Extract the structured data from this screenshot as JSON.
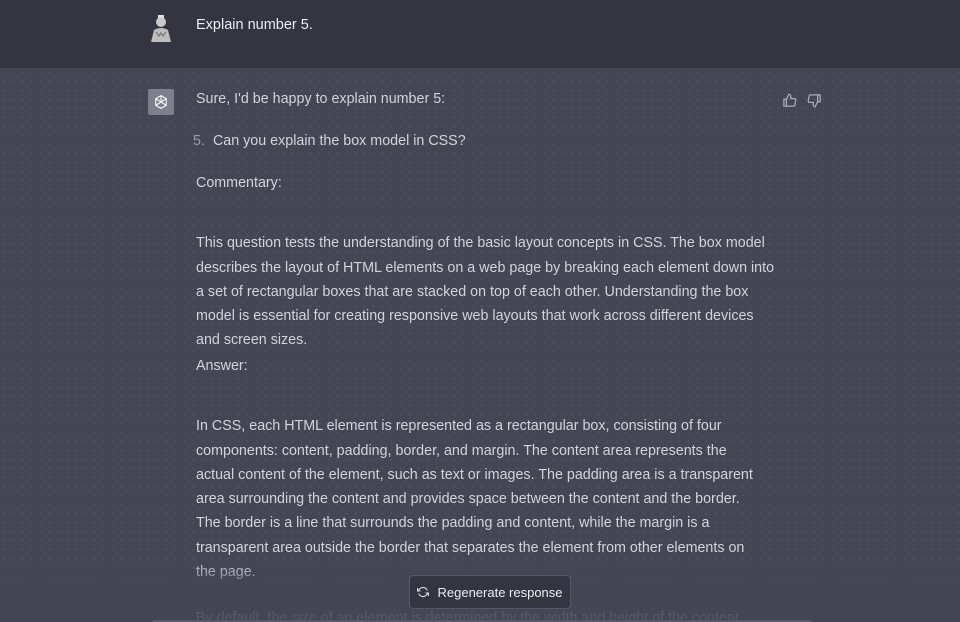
{
  "user_message": {
    "text": "Explain number 5."
  },
  "assistant_message": {
    "intro": "Sure, I'd be happy to explain number 5:",
    "list_number": "5.",
    "list_item": "Can you explain the box model in CSS?",
    "commentary_label": "Commentary:",
    "commentary_text": "This question tests the understanding of the basic layout concepts in CSS. The box model describes the layout of HTML elements on a web page by breaking each element down into a set of rectangular boxes that are stacked on top of each other. Understanding the box model is essential for creating responsive web layouts that work across different devices and screen sizes.",
    "answer_label": "Answer:",
    "answer_text": "In CSS, each HTML element is represented as a rectangular box, consisting of four components: content, padding, border, and margin. The content area represents the actual content of the element, such as text or images. The padding area is a transparent area surrounding the content and provides space between the content and the border. The border is a line that surrounds the padding and content, while the margin is a transparent area outside the border that separates the element from other elements on the page.",
    "faded_text": "By default, the size of an element is determined by the width and height of the content"
  },
  "actions": {
    "regenerate_label": "Regenerate response"
  },
  "icons": {
    "user_avatar": "user-avatar",
    "assistant_avatar": "openai-logo-icon",
    "thumbs_up": "thumbs-up-icon",
    "thumbs_down": "thumbs-down-icon",
    "regenerate": "refresh-icon"
  }
}
